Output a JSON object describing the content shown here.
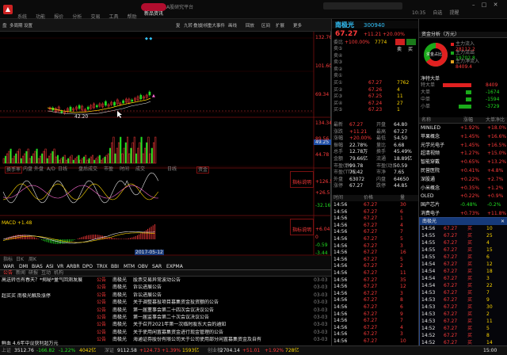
{
  "titlebar": {
    "logo_text": "▲",
    "menu": [
      "系统",
      "功能",
      "报价",
      "分析",
      "交易",
      "工具",
      "帮助"
    ],
    "center_pill": "新品资讯",
    "center_sub": "A股研究平台",
    "right_items": [
      "10:35",
      "自选",
      "提醒"
    ]
  },
  "toolbar": {
    "items": [
      "盘",
      "多周期",
      "设置",
      "复",
      "九转",
      "叠加",
      "分析",
      "重大事件",
      "画线",
      "回放",
      "区间",
      "扩展",
      "更多"
    ]
  },
  "chart": {
    "y_ticks_price": [
      "132.76",
      "101.60",
      "69.34",
      "49.25"
    ],
    "y_ticks_vol": [
      "134.34",
      "89.56",
      "44.78"
    ],
    "y_ticks_ind1": [
      "+126.5",
      "+26.5",
      "-32.16"
    ],
    "y_ticks_ind2": [
      "+6.04",
      "0",
      "-0.59",
      "-3.44"
    ],
    "low_marker": "42.20",
    "volume_tabs": [
      "换手率",
      "内盘",
      "外盘",
      "A/D",
      "日线",
      "盘后成交",
      "市盈",
      "时间",
      "成交",
      "日线",
      "资金"
    ],
    "panel_btn": "指标说明",
    "bottom_tabs": [
      "指标",
      "日K",
      "周K",
      "WAR",
      "DMI",
      "BIAS",
      "ASI",
      "VR",
      "ARBR",
      "DPO",
      "TRIX",
      "BBI",
      "MTM",
      "OBV",
      "SAR",
      "EXPMA"
    ],
    "ind2_label": "MACD +1.48",
    "date_label": "2017-05-12",
    "ma_label": "MA5 MA10",
    "price_hint": "132.76"
  },
  "news": {
    "header": [
      "公告",
      "新闻",
      "研报",
      "互动",
      "机构"
    ],
    "left_items": [
      "高送转也有春天？*揭秘*量气回测发展",
      "超买买 南极光触及涨停",
      "",
      "",
      "",
      "",
      "",
      "鲜血 4.6年中设获利超万元"
    ],
    "rows": [
      {
        "tag": "公告",
        "company": "南极光",
        "title": "股票交易异常波动公告",
        "date": "03-03"
      },
      {
        "tag": "公告",
        "company": "南极光",
        "title": "诉讼进展公告",
        "date": "03-03"
      },
      {
        "tag": "公告",
        "company": "南极光",
        "title": "诉讼进展公告",
        "date": "03-03"
      },
      {
        "tag": "公告",
        "company": "南极光",
        "title": "关于调整募投项目募集资金投资额的公告",
        "date": "03-03"
      },
      {
        "tag": "公告",
        "company": "南极光",
        "title": "第一届董事会第二十四次会议决议公告",
        "date": "03-03"
      },
      {
        "tag": "公告",
        "company": "南极光",
        "title": "第一届监事会第二十次会议决议公告",
        "date": "03-03"
      },
      {
        "tag": "公告",
        "company": "南极光",
        "title": "关于召开2021年第一次临时股东大会的通知",
        "date": "03-03"
      },
      {
        "tag": "公告",
        "company": "南极光",
        "title": "关于使用闲置募集资金进行现金管理的公告",
        "date": "03-03"
      },
      {
        "tag": "公告",
        "company": "南极光",
        "title": "海通证券股份有限公司关于公司使用部分闲置募集资金及自有",
        "date": "03-03"
      }
    ]
  },
  "quote": {
    "name": "南极光",
    "code": "300940",
    "price": "67.27",
    "change": "+11.21",
    "pct": "+20.00%",
    "ratio_label": "委比",
    "ratio": "+100.00%",
    "ratio_vol": "7774",
    "sell_levels": [
      [
        "卖⑤",
        "",
        ""
      ],
      [
        "卖④",
        "",
        ""
      ],
      [
        "卖③",
        "",
        ""
      ],
      [
        "卖②",
        "",
        ""
      ],
      [
        "卖①",
        "",
        ""
      ]
    ],
    "buy_levels": [
      [
        "买①",
        "67.27",
        "7762"
      ],
      [
        "买②",
        "67.26",
        "4"
      ],
      [
        "买③",
        "67.25",
        "11"
      ],
      [
        "买④",
        "67.24",
        "27"
      ],
      [
        "买⑤",
        "67.23",
        "1"
      ]
    ],
    "stats": [
      [
        "最新",
        "67.27",
        "开盘",
        "64.80"
      ],
      [
        "涨跌",
        "+11.21",
        "最高",
        "67.27"
      ],
      [
        "涨幅",
        "+20.00%",
        "最低",
        "54.50"
      ],
      [
        "振幅",
        "22.78%",
        "量比",
        "6.68"
      ],
      [
        "总手",
        "12.78万",
        "换手",
        "45.49%"
      ],
      [
        "金额",
        "79.66亿",
        "流通",
        "18.89亿"
      ],
      [
        "市盈(静)",
        "99.78",
        "市盈(动)",
        "50.59"
      ],
      [
        "市盈(TTM)",
        "75.42",
        "市净",
        "7.65"
      ],
      [
        "外盘",
        "63072",
        "内盘",
        "64650"
      ],
      [
        "涨停",
        "67.27",
        "跌停",
        "44.85"
      ]
    ],
    "tick_header": [
      "时间",
      "价格",
      "量"
    ],
    "ticks": [
      [
        "14:56",
        "67.27",
        "30"
      ],
      [
        "14:56",
        "67.27",
        "6"
      ],
      [
        "14:56",
        "67.27",
        "1"
      ],
      [
        "14:56",
        "67.27",
        "4"
      ],
      [
        "14:56",
        "67.27",
        "7"
      ],
      [
        "14:56",
        "67.27",
        "5"
      ],
      [
        "14:56",
        "67.27",
        "3"
      ],
      [
        "14:56",
        "67.27",
        "16"
      ],
      [
        "14:56",
        "67.27",
        "5"
      ],
      [
        "14:56",
        "67.27",
        "2"
      ],
      [
        "14:56",
        "67.27",
        "11"
      ],
      [
        "14:56",
        "67.27",
        "35"
      ],
      [
        "14:56",
        "67.27",
        "12"
      ],
      [
        "14:56",
        "67.27",
        "3"
      ],
      [
        "14:56",
        "67.27",
        "8"
      ],
      [
        "14:56",
        "67.27",
        "6"
      ],
      [
        "14:56",
        "67.27",
        "9"
      ],
      [
        "14:56",
        "67.27",
        "7"
      ],
      [
        "14:56",
        "67.27",
        "4"
      ],
      [
        "14:56",
        "67.27",
        "3"
      ],
      [
        "14:56",
        "67.27",
        "10"
      ]
    ],
    "tabs": [
      "分时",
      "五档",
      "明细",
      "资金"
    ]
  },
  "fund": {
    "title": "资金分析（万元）",
    "legend": [
      [
        "主力流入",
        "28112.2"
      ],
      [
        "主力流出",
        "19702.8"
      ],
      [
        "主力净流入",
        "8409.4"
      ]
    ],
    "pie_label": "资金占比",
    "net_title": "净特大单",
    "net_rows": [
      [
        "特大单",
        "8409"
      ],
      [
        "大单",
        "-1674"
      ],
      [
        "中单",
        "-1594"
      ],
      [
        "小单",
        "-3729"
      ]
    ],
    "net_values": [
      8409,
      -1674,
      -1594,
      -3729
    ],
    "sector_header": [
      "名称",
      "涨幅",
      "大单净比"
    ],
    "sectors": [
      [
        "MINILED",
        "+1.92%",
        "+18.0%"
      ],
      [
        "苹果概念",
        "+1.45%",
        "+16.6%"
      ],
      [
        "光学光电子",
        "+1.45%",
        "+16.5%"
      ],
      [
        "超清视频",
        "+1.27%",
        "+15.0%"
      ],
      [
        "智能穿戴",
        "+0.65%",
        "+13.2%"
      ],
      [
        "民营医院",
        "+0.41%",
        "+4.8%"
      ],
      [
        "深股通",
        "+0.22%",
        "+2.7%"
      ],
      [
        "小米概念",
        "+0.35%",
        "+1.2%"
      ],
      [
        "OLED",
        "+0.22%",
        "+0.9%"
      ],
      [
        "国产芯片",
        "-0.48%",
        "-0.2%"
      ],
      [
        "消费电子",
        "+0.73%",
        "+11.8%"
      ]
    ],
    "popup_title": "南极光",
    "popup_rows": [
      [
        "14:56",
        "67.27",
        "买",
        "10"
      ],
      [
        "14:55",
        "67.27",
        "买",
        "25"
      ],
      [
        "14:55",
        "67.27",
        "买",
        "4"
      ],
      [
        "14:55",
        "67.27",
        "买",
        "15"
      ],
      [
        "14:55",
        "67.27",
        "买",
        "6"
      ],
      [
        "14:54",
        "67.27",
        "买",
        "12"
      ],
      [
        "14:54",
        "67.27",
        "买",
        "18"
      ],
      [
        "14:54",
        "67.27",
        "买",
        "3"
      ],
      [
        "14:54",
        "67.27",
        "买",
        "22"
      ],
      [
        "14:53",
        "67.27",
        "买",
        "7"
      ],
      [
        "14:53",
        "67.27",
        "买",
        "9"
      ],
      [
        "14:53",
        "67.27",
        "买",
        "30"
      ],
      [
        "14:53",
        "67.27",
        "买",
        "2"
      ],
      [
        "14:53",
        "67.27",
        "买",
        "11"
      ],
      [
        "14:52",
        "67.27",
        "买",
        "5"
      ],
      [
        "14:52",
        "67.27",
        "买",
        "8"
      ],
      [
        "14:52",
        "67.27",
        "买",
        "14"
      ]
    ]
  },
  "status": {
    "items": [
      [
        "上证",
        "3512.76",
        "-166.82",
        "-1.22%",
        "4042亿"
      ],
      [
        "深证",
        "9112.58",
        "+124.73",
        "+1.39%",
        "1593亿"
      ],
      [
        "创业板",
        "2704.14",
        "+51.01",
        "+1.92%",
        "728亿"
      ]
    ],
    "clock": "15:00"
  },
  "colors": {
    "up": "#ff3b3b",
    "down": "#22dd22",
    "title_blue": "#33c6ff",
    "grid": "#3a0000",
    "ma_yellow": "#ffd700"
  }
}
